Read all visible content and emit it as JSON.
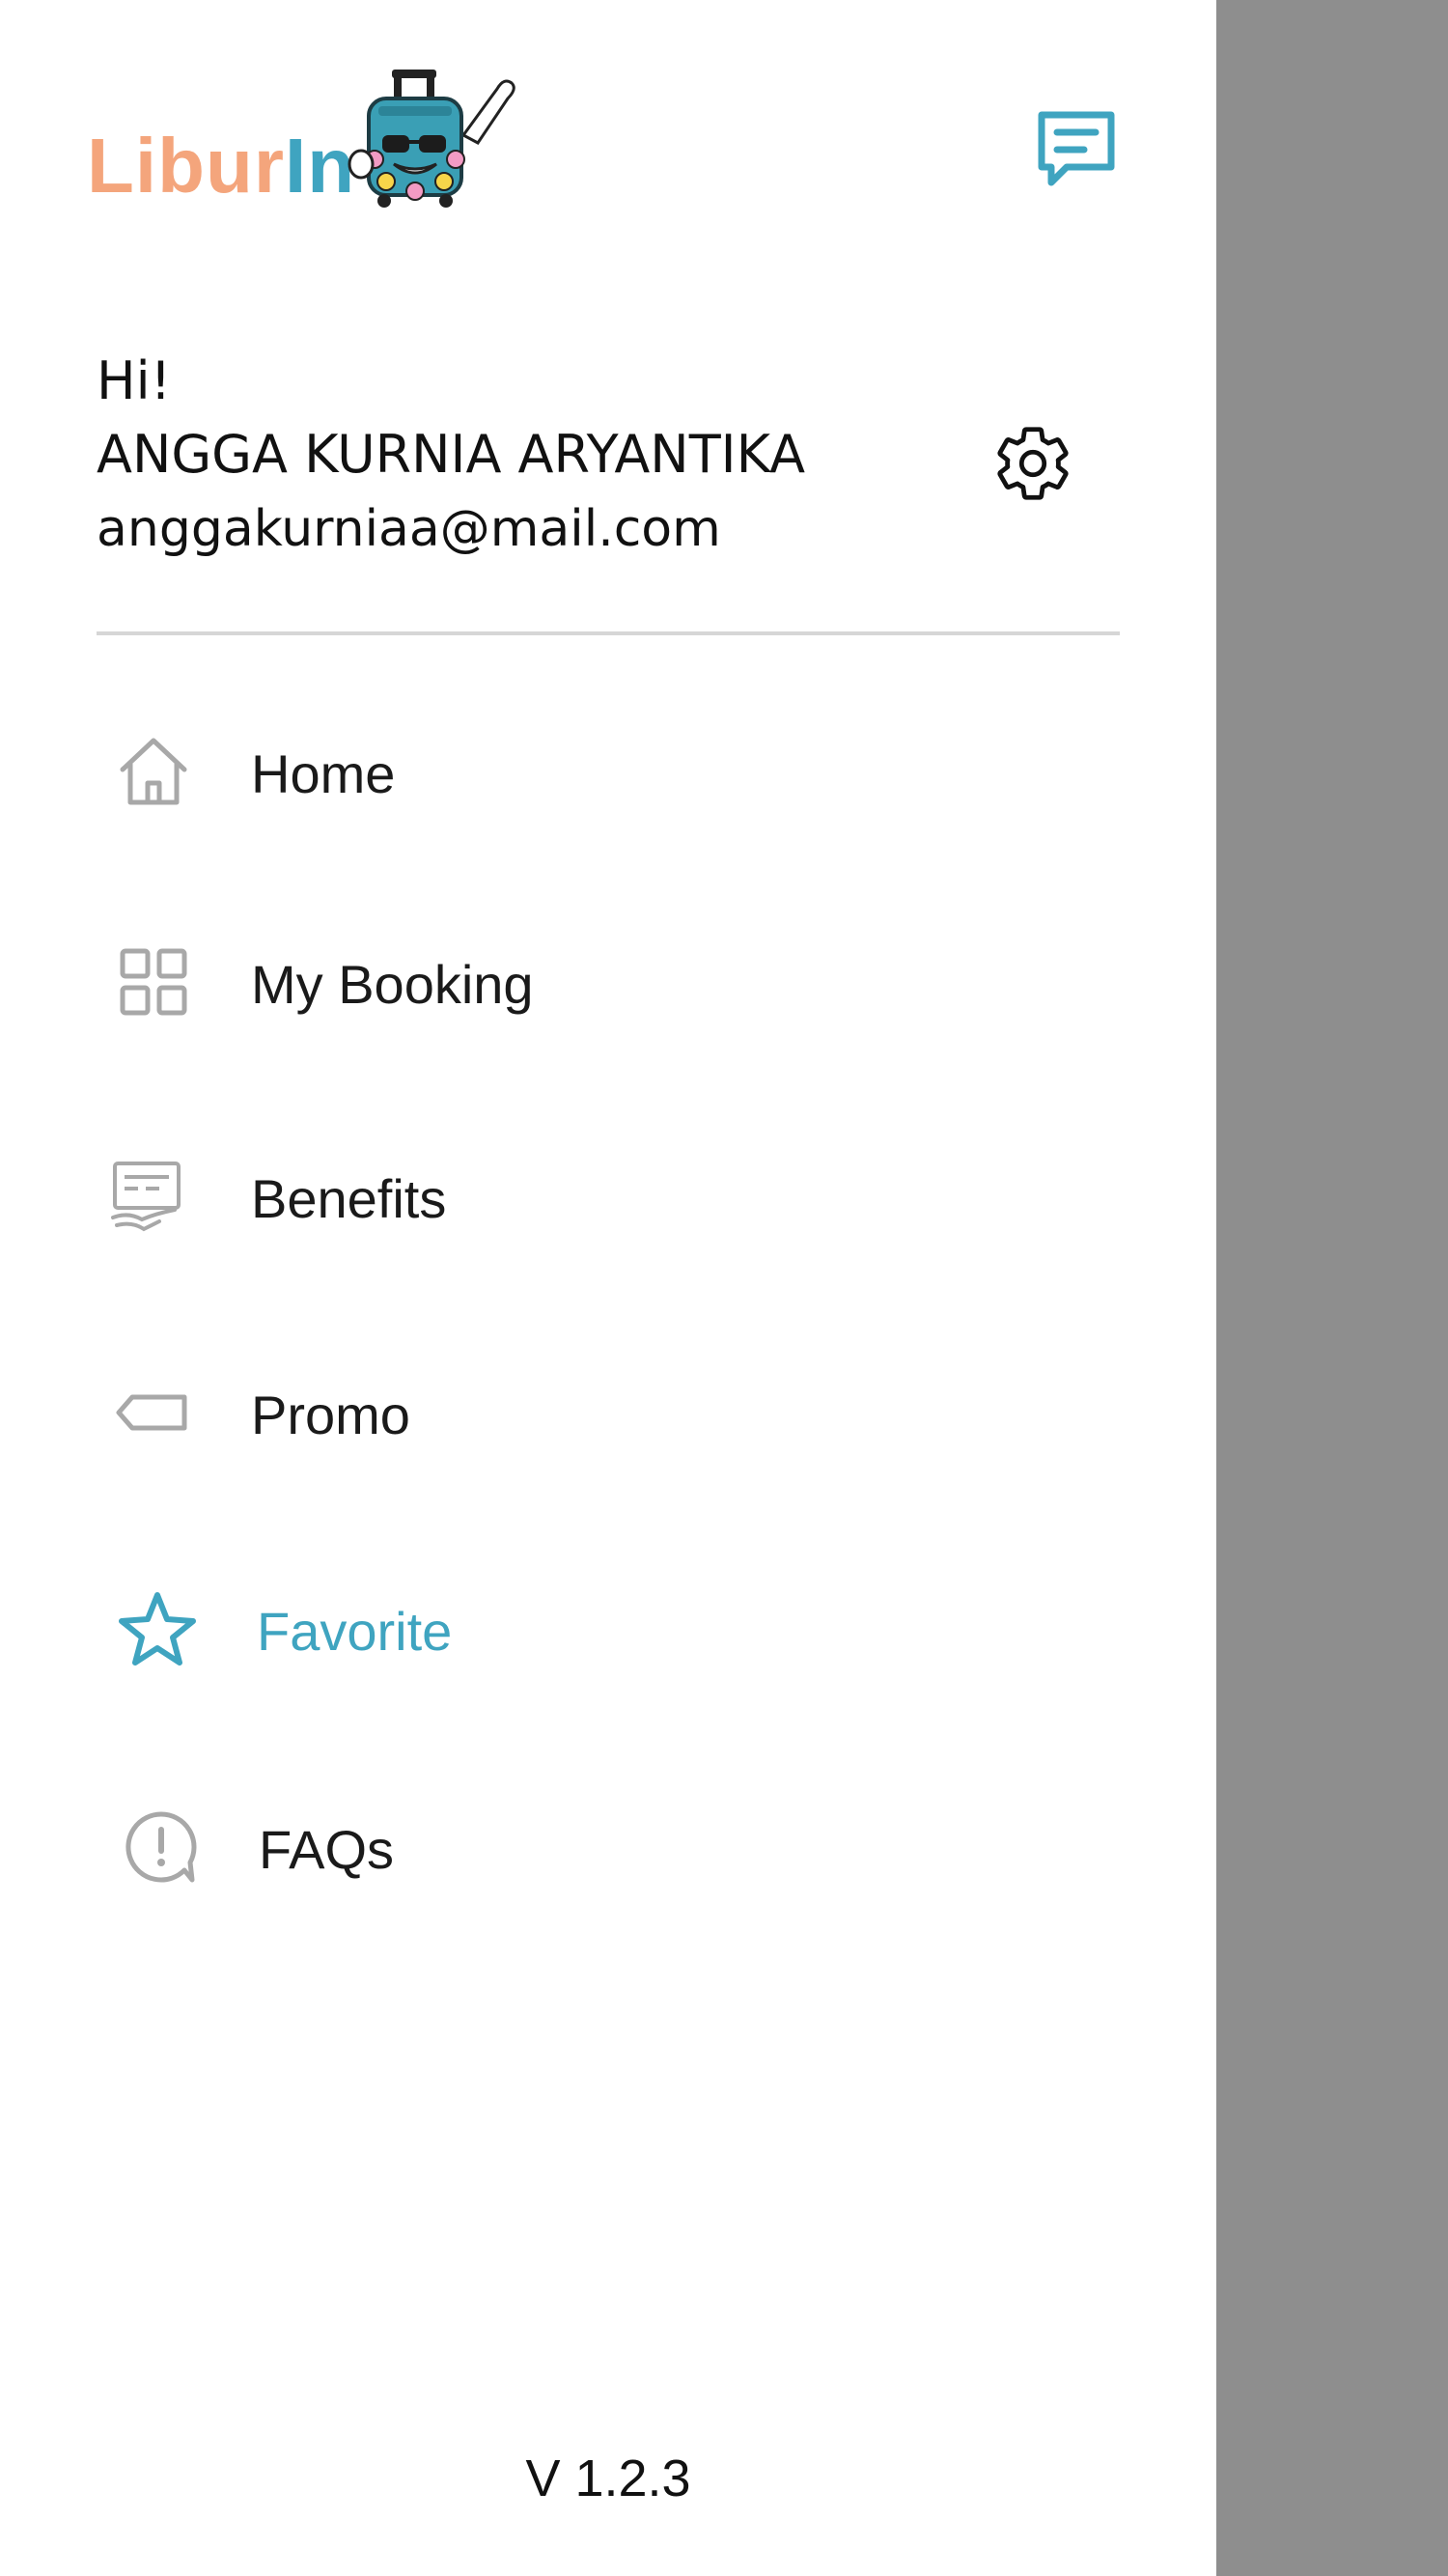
{
  "app": {
    "logo_part1": "Libur",
    "logo_part2": "In",
    "brand_color_orange": "#f4a57c",
    "brand_color_teal": "#3fa4c0"
  },
  "header": {
    "chat_icon": "chat-bubble-icon",
    "settings_icon": "gear-icon"
  },
  "user": {
    "greeting": "Hi!",
    "name": "ANGGA KURNIA ARYANTIKA",
    "email": "anggakurniaa@mail.com"
  },
  "menu": {
    "items": [
      {
        "label": "Home",
        "icon": "home-icon",
        "active": false
      },
      {
        "label": "My Booking",
        "icon": "grid-icon",
        "active": false
      },
      {
        "label": "Benefits",
        "icon": "benefit-card-icon",
        "active": false
      },
      {
        "label": "Promo",
        "icon": "tag-icon",
        "active": false
      },
      {
        "label": "Favorite",
        "icon": "star-icon",
        "active": true
      },
      {
        "label": "FAQs",
        "icon": "question-bubble-icon",
        "active": false
      }
    ]
  },
  "footer": {
    "version": "V 1.2.3"
  },
  "colors": {
    "active": "#3fa4c0",
    "icon_inactive": "#a8a8a8",
    "scrim": "#8e8e8e"
  }
}
